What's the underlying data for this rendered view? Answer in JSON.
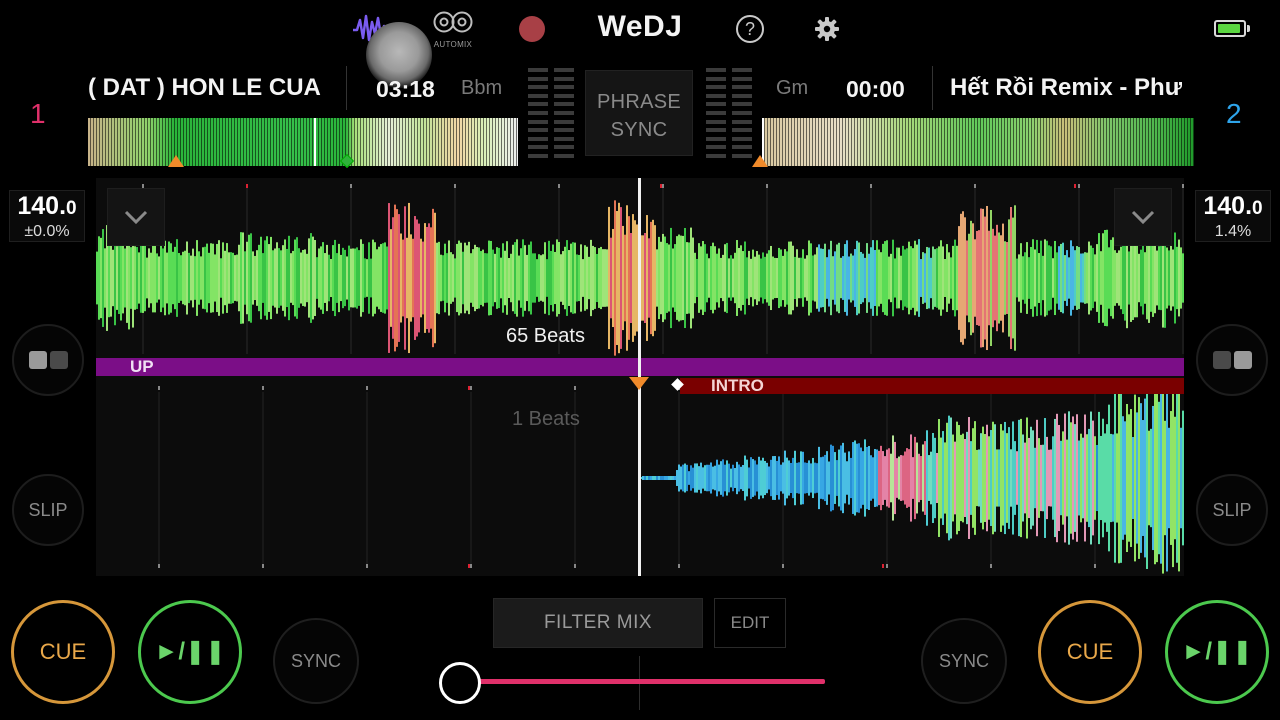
{
  "app": {
    "title": "WeDJ",
    "automix_label": "AUTOMIX"
  },
  "colors": {
    "deck_a": "#e0306a",
    "deck_b": "#2ea4ea",
    "cue": "#d6973a",
    "play": "#4cc94e",
    "phrase_up": "#7b0e87",
    "phrase_intro": "#7a0000",
    "crossfader": "#e0306a",
    "battery": "#5bd641"
  },
  "deck_a": {
    "number": "1",
    "title": "( DAT ) HON LE CUA",
    "time": "03:18",
    "key": "Bbm",
    "bpm_main": "140.",
    "bpm_decimal": "0",
    "pitch": "±0.0%",
    "beats_label": "65 Beats",
    "phrase_label": "UP",
    "cue_label": "CUE",
    "play_label": "►/❚❚",
    "sync_label": "SYNC",
    "slip_label": "SLIP"
  },
  "deck_b": {
    "number": "2",
    "title": "Hết Rồi Remix - Phư",
    "time": "00:00",
    "key": "Gm",
    "bpm_main": "140.",
    "bpm_decimal": "0",
    "pitch": "1.4%",
    "beats_label": "1 Beats",
    "phrase_label": "INTRO",
    "cue_label": "CUE",
    "play_label": "►/❚❚",
    "sync_label": "SYNC",
    "slip_label": "SLIP"
  },
  "mixer": {
    "phrase_sync_line1": "PHRASE",
    "phrase_sync_line2": "SYNC",
    "filter_mix_label": "FILTER MIX",
    "edit_label": "EDIT",
    "crossfader_position": 0.0
  },
  "icons": {
    "waveform": "waveform-icon",
    "automix": "automix-icon",
    "record": "record-icon",
    "help": "help-icon",
    "settings": "gear-icon",
    "battery": "battery-icon",
    "zoom": "chevron-down-icon",
    "pads": "pad-icon"
  }
}
